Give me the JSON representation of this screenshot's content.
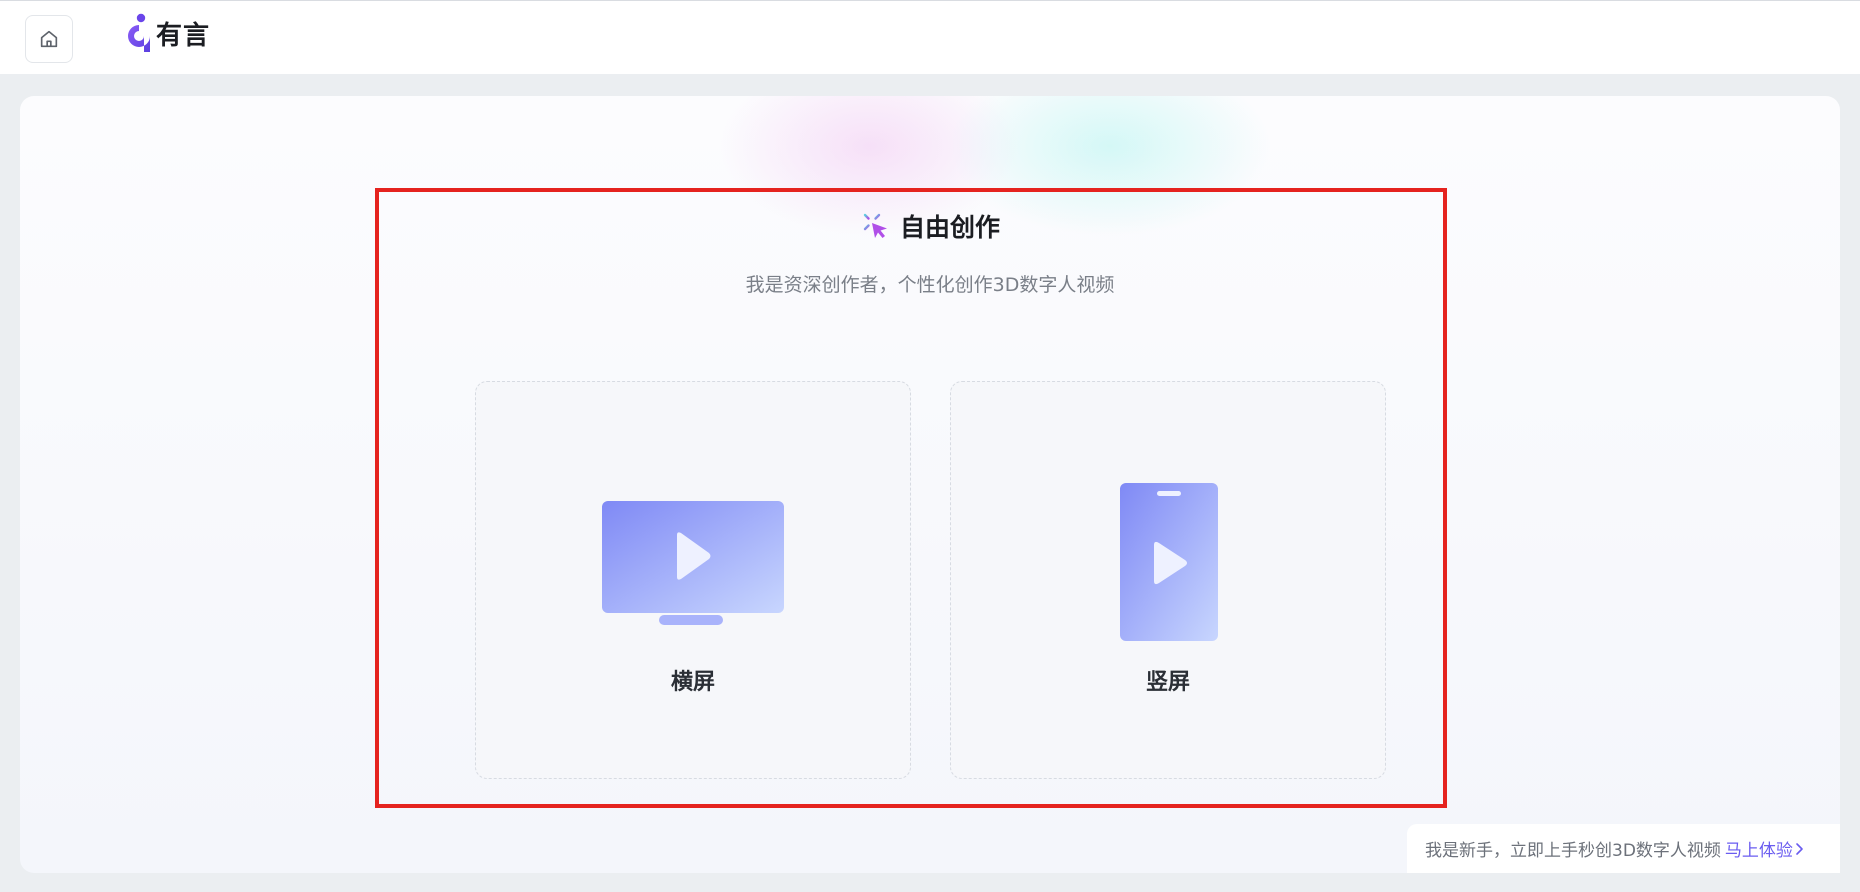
{
  "header": {
    "logo_text": "有言"
  },
  "main": {
    "title": "自由创作",
    "subtitle": "我是资深创作者，个性化创作3D数字人视频",
    "cards": [
      {
        "label": "横屏",
        "icon": "landscape-monitor-icon"
      },
      {
        "label": "竖屏",
        "icon": "portrait-phone-icon"
      }
    ]
  },
  "footer_tip": {
    "text": "我是新手，立即上手秒创3D数字人视频",
    "link_text": "马上体验"
  },
  "colors": {
    "accent": "#6a5cf0",
    "highlight_border": "#e5231f",
    "icon_gradient_start": "#7f89f5",
    "icon_gradient_end": "#c8d6fe"
  }
}
